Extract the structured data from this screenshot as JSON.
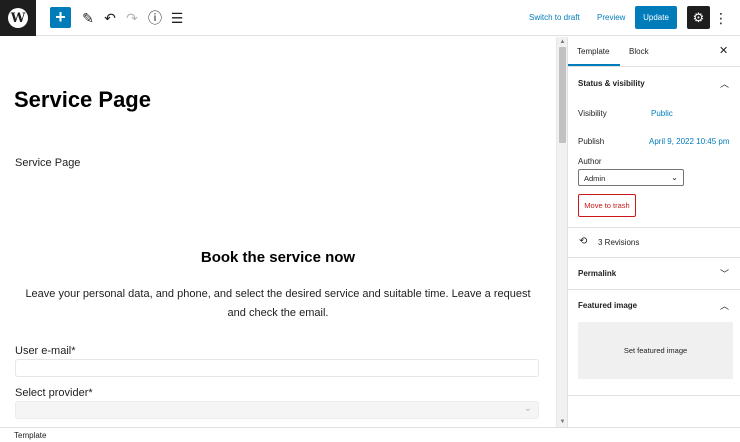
{
  "toolbar": {
    "logo": "W",
    "add_icon": "+",
    "tools_icon": "✎",
    "undo_icon": "↶",
    "redo_icon": "↷",
    "details_icon": "ⓘ",
    "list_view_icon": "☰",
    "switch_to_draft": "Switch to draft",
    "preview": "Preview",
    "update": "Update",
    "settings_icon": "⚙",
    "more_icon": "⋮"
  },
  "canvas": {
    "title": "Service Page",
    "paragraph": "Service Page",
    "book_title": "Book the service now",
    "book_description": "Leave your personal data, and phone, and select the desired service and suitable time. Leave a request and check the email.",
    "email_label": "User e-mail*",
    "email_value": "",
    "provider_label": "Select provider*",
    "provider_value": ""
  },
  "sidebar": {
    "tabs": [
      "Template",
      "Block"
    ],
    "close_icon": "✕",
    "status_visibility": {
      "heading": "Status & visibility",
      "visibility_label": "Visibility",
      "visibility_value": "Public",
      "publish_label": "Publish",
      "publish_value": "April 9, 2022 10:45 pm",
      "author_label": "Author",
      "author_value": "Admin",
      "move_to_trash": "Move to trash"
    },
    "revisions": "3 Revisions",
    "permalink": "Permalink",
    "featured_image": {
      "heading": "Featured image",
      "button": "Set featured image"
    }
  },
  "footer": {
    "breadcrumb": "Template"
  },
  "colors": {
    "accent": "#007cba",
    "danger": "#cc1818",
    "dark": "#1e1e1e"
  }
}
